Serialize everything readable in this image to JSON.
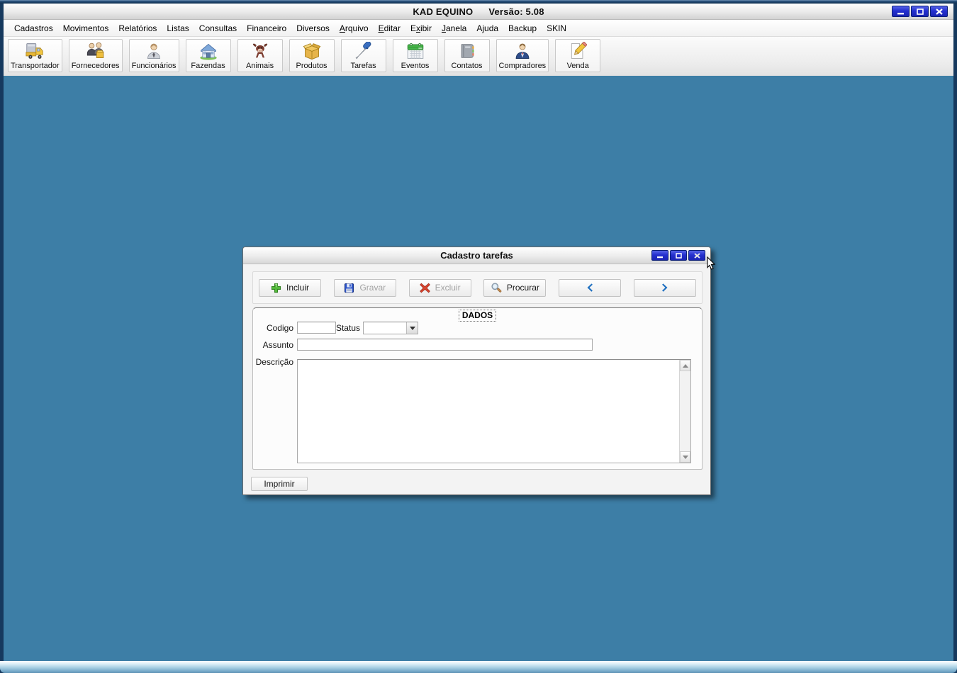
{
  "window": {
    "title": "KAD EQUINO",
    "version": "Versão: 5.08"
  },
  "menu_bar": {
    "items": [
      {
        "label": "Cadastros"
      },
      {
        "label": "Movimentos"
      },
      {
        "label": "Relatórios"
      },
      {
        "label": "Listas"
      },
      {
        "label": "Consultas"
      },
      {
        "label": "Financeiro"
      },
      {
        "label": "Diversos"
      },
      {
        "label": "Arquivo",
        "underline": 0
      },
      {
        "label": "Editar",
        "underline": 0
      },
      {
        "label": "Exibir",
        "underline": 1
      },
      {
        "label": "Janela",
        "underline": 0
      },
      {
        "label": "Ajuda"
      },
      {
        "label": "Backup"
      },
      {
        "label": "SKIN"
      }
    ]
  },
  "toolbar": {
    "buttons": [
      {
        "label": "Transportador",
        "icon": "truck-icon"
      },
      {
        "label": "Fornecedores",
        "icon": "suppliers-icon"
      },
      {
        "label": "Funcionários",
        "icon": "employee-icon"
      },
      {
        "label": "Fazendas",
        "icon": "farm-house-icon"
      },
      {
        "label": "Animais",
        "icon": "cow-icon"
      },
      {
        "label": "Produtos",
        "icon": "box-icon"
      },
      {
        "label": "Tarefas",
        "icon": "screwdriver-icon"
      },
      {
        "label": "Eventos",
        "icon": "calendar-icon"
      },
      {
        "label": "Contatos",
        "icon": "address-book-icon"
      },
      {
        "label": "Compradores",
        "icon": "buyer-icon"
      },
      {
        "label": "Venda",
        "icon": "pencil-icon"
      }
    ]
  },
  "dialog": {
    "title": "Cadastro tarefas",
    "buttons": [
      {
        "name": "incluir-button",
        "label": "Incluir",
        "icon": "plus-icon",
        "enabled": true
      },
      {
        "name": "gravar-button",
        "label": "Gravar",
        "icon": "save-icon",
        "enabled": false
      },
      {
        "name": "excluir-button",
        "label": "Excluir",
        "icon": "delete-icon",
        "enabled": false
      },
      {
        "name": "procurar-button",
        "label": "Procurar",
        "icon": "search-icon",
        "enabled": true
      },
      {
        "name": "previous-button",
        "label": "",
        "icon": "arrow-left-icon",
        "enabled": true
      },
      {
        "name": "next-button",
        "label": "",
        "icon": "arrow-right-icon",
        "enabled": true
      }
    ],
    "group_title": "DADOS",
    "fields": {
      "codigo": {
        "label": "Codigo",
        "value": ""
      },
      "status": {
        "label": "Status",
        "value": ""
      },
      "assunto": {
        "label": "Assunto",
        "value": ""
      },
      "descricao": {
        "label": "Descrição",
        "value": ""
      }
    },
    "print_button_label": "Imprimir"
  },
  "colors": {
    "client_bg": "#3d7ea6",
    "frame": "#16395e",
    "window_button_blue": "#2430cf",
    "arrow_accent": "#1e6fc0"
  }
}
